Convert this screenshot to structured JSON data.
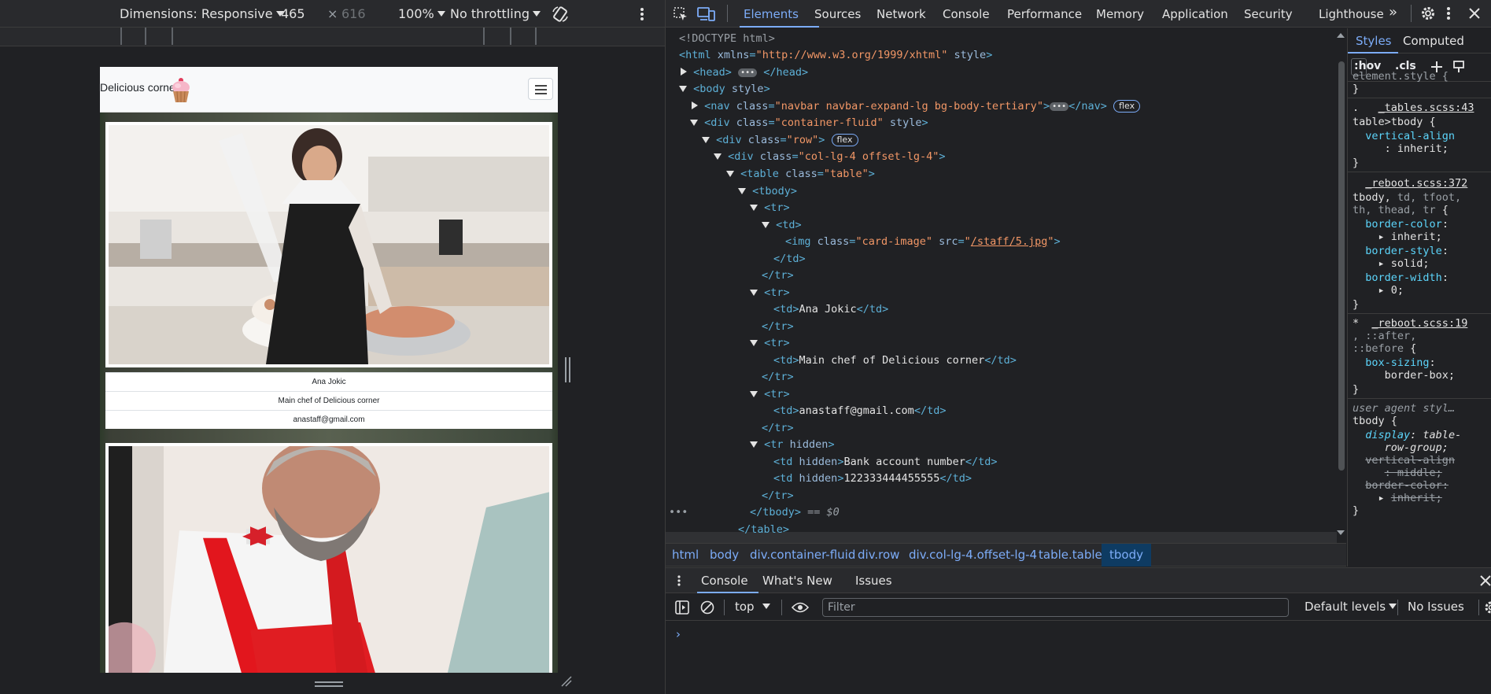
{
  "device_toolbar": {
    "dimensions_label": "Dimensions: Responsive",
    "width_value": "465",
    "times": "×",
    "height_value": "616",
    "zoom": "100%",
    "throttling": "No throttling"
  },
  "site": {
    "brand": "Delicious corner",
    "rows": [
      {
        "name": "Ana Jokic",
        "role": "Main chef of Delicious corner",
        "email": "anastaff@gmail.com"
      }
    ]
  },
  "devtools": {
    "tabs": [
      "Elements",
      "Sources",
      "Network",
      "Console",
      "Performance",
      "Memory",
      "Application",
      "Security",
      "Lighthouse"
    ],
    "more_tabs": "»",
    "dom": {
      "doctype": "<!DOCTYPE html>",
      "html_open": "<html",
      "html_attr": "xmlns",
      "html_val": "\"http://www.w3.org/1999/xhtml\"",
      "style": "style",
      "head": "<head>",
      "head_close": "</head>",
      "body": "<body",
      "nav_open": "<nav",
      "class_attr": "class",
      "nav_class": "\"navbar navbar-expand-lg bg-body-tertiary\"",
      "nav_close": "</nav>",
      "flex": "flex",
      "div": "<div",
      "container_class": "\"container-fluid\"",
      "row_class": "\"row\"",
      "col_class": "\"col-lg-4 offset-lg-4\"",
      "table": "<table",
      "table_class": "\"table\"",
      "tbody": "<tbody>",
      "tr": "<tr>",
      "td": "<td>",
      "img": "<img",
      "img_class": "\"card-image\"",
      "src": "src",
      "src_val": "/staff/5.jpg",
      "td_close": "</td>",
      "tr_close": "</tr>",
      "name_text": "Ana Jokic",
      "role_text": "Main chef of Delicious corner",
      "email_text": "anastaff@gmail.com",
      "tr_hidden": "<tr",
      "hidden": "hidden",
      "td_hidden": "<td",
      "bank_label": "Bank account number",
      "bank_number": "122333444455555",
      "tbody_close": "</tbody>",
      "eq0": "== $0",
      "table_close": "</table>",
      "dots": "•••"
    },
    "breadcrumbs": [
      "html",
      "body",
      "div.container-fluid",
      "div.row",
      "div.col-lg-4.offset-lg-4",
      "table.table",
      "tbody"
    ],
    "styles": {
      "tabs": [
        "Styles",
        "Computed"
      ],
      "filter": ":hov",
      "cls": ".cls",
      "element_style": "element.style {",
      "close_brace": "}",
      "r1_src": "_tables.scss:43",
      "r1_dot": ".",
      "r1_sel": "table>tbody {",
      "r1_prop": "vertical-align",
      "r1_val": ": inherit;",
      "r2_src": "_reboot.scss:372",
      "r2_sel_a": "tbody,",
      "r2_sel_b": " td, tfoot,",
      "r2_sel_c": "th, thead, tr",
      "r2_brace": " {",
      "r2_p1": "border-color",
      "r2_v1": "inherit;",
      "r2_p2": "border-style",
      "r2_v2": "solid;",
      "r2_p3": "border-width",
      "r2_v3": "0;",
      "r3_star": "*",
      "r3_src": "_reboot.scss:19",
      "r3_sel_a": ", ::after,",
      "r3_sel_b": "::before",
      "r3_p": "box-sizing",
      "r3_v": "border-box;",
      "ua": "user agent styl…",
      "ua_sel": "tbody {",
      "ua_p1": "display",
      "ua_v1a": ": table-",
      "ua_v1b": "row-group;",
      "ua_p2": "vertical-align",
      "ua_v2": ": middle;",
      "ua_p3": "border-color",
      "ua_v3": "inherit;",
      "colon": ":"
    },
    "drawer": {
      "tabs": [
        "Console",
        "What's New",
        "Issues"
      ],
      "context": "top",
      "filter_placeholder": "Filter",
      "levels": "Default levels",
      "issues": "No Issues",
      "prompt": "›"
    }
  }
}
